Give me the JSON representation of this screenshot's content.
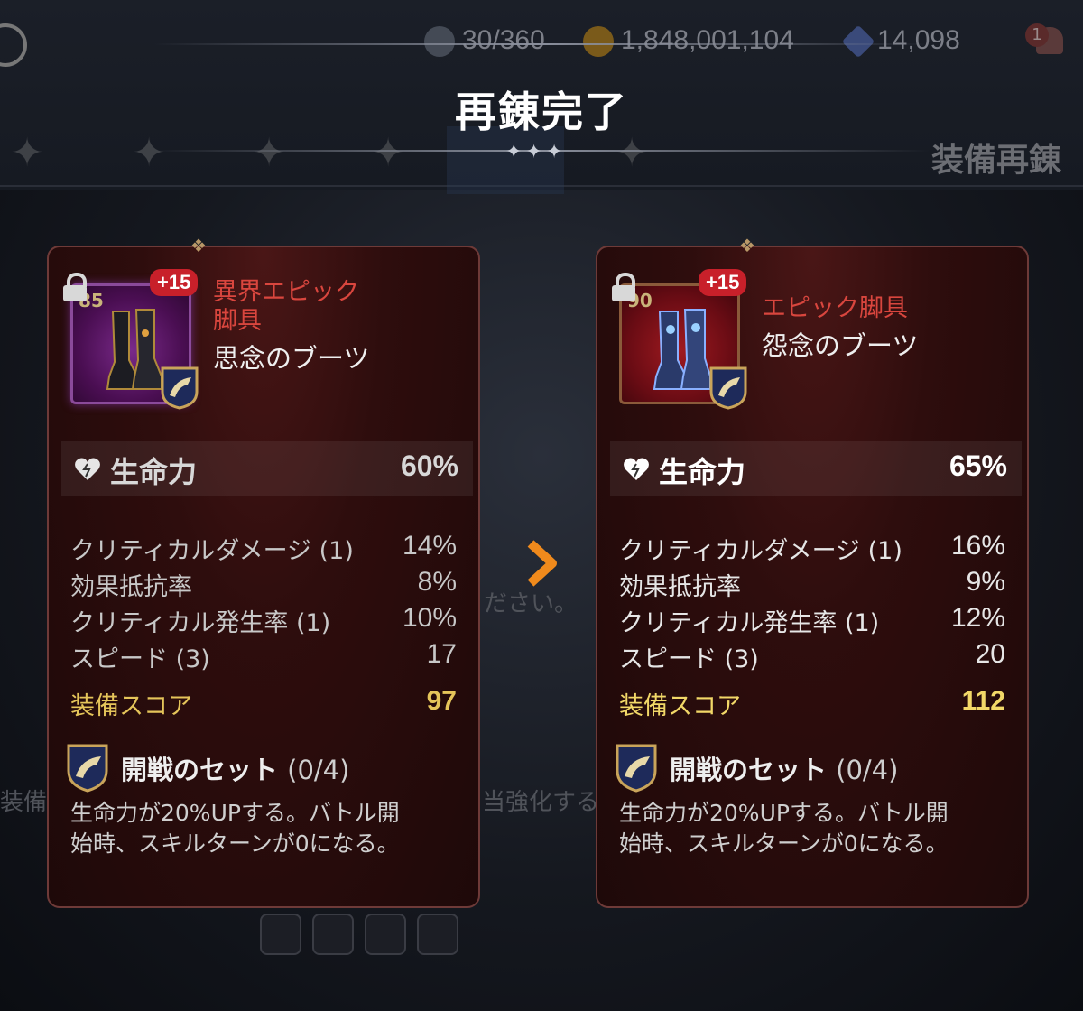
{
  "header": {
    "stamina": "30/360",
    "gold": "1,848,001,104",
    "crystal": "14,098",
    "notification_count": "1"
  },
  "background": {
    "right_title": "装備再錬",
    "hint_left": "装備再",
    "hint_mid": "ださい。",
    "hint_mid2": "当強化する"
  },
  "title": "再錬完了",
  "before": {
    "enhance": "+15",
    "level": "85",
    "rarity": "異界エピック脚具",
    "rarity_line1": "異界エピック",
    "rarity_line2": "脚具",
    "name": "思念のブーツ",
    "main_stat": {
      "label": "生命力",
      "value": "60%"
    },
    "sub_stats": [
      {
        "label": "クリティカルダメージ (1)",
        "value": "14%"
      },
      {
        "label": "効果抵抗率",
        "value": "8%"
      },
      {
        "label": "クリティカル発生率 (1)",
        "value": "10%"
      },
      {
        "label": "スピード (3)",
        "value": "17"
      }
    ],
    "score": {
      "label": "装備スコア",
      "value": "97"
    },
    "set": {
      "name": "開戦のセット",
      "count": "(0/4)"
    },
    "set_desc_line1": "生命力が20%UPする。バトル開",
    "set_desc_line2": "始時、スキルターンが0になる。"
  },
  "after": {
    "enhance": "+15",
    "level": "90",
    "rarity": "エピック脚具",
    "name": "怨念のブーツ",
    "main_stat": {
      "label": "生命力",
      "value": "65%"
    },
    "sub_stats": [
      {
        "label": "クリティカルダメージ (1)",
        "value": "16%"
      },
      {
        "label": "効果抵抗率",
        "value": "9%"
      },
      {
        "label": "クリティカル発生率 (1)",
        "value": "12%"
      },
      {
        "label": "スピード (3)",
        "value": "20"
      }
    ],
    "score": {
      "label": "装備スコア",
      "value": "112"
    },
    "set": {
      "name": "開戦のセット",
      "count": "(0/4)"
    },
    "set_desc_line1": "生命力が20%UPする。バトル開",
    "set_desc_line2": "始時、スキルターンが0になる。"
  },
  "colors": {
    "rarity_red": "#d9463e",
    "score_gold": "#e5c55a",
    "arrow_orange": "#f08a1c",
    "card_border": "#6e3a38"
  },
  "icons": {
    "set_badge": "horn-emblem-icon",
    "lock": "lock-icon",
    "main_stat": "heart-icon",
    "arrow": "chevron-right-icon"
  }
}
